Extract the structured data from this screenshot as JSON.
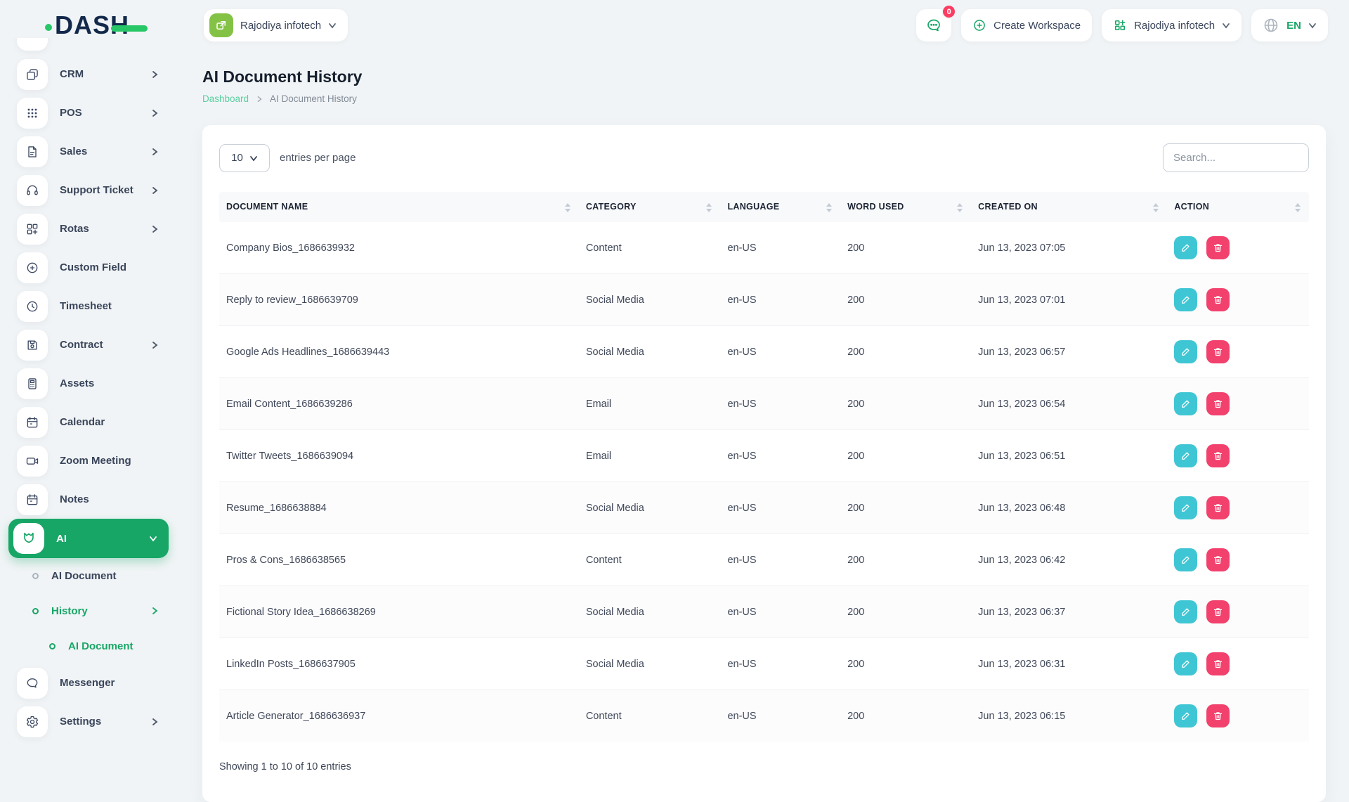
{
  "app": {
    "logo": "DASH"
  },
  "header": {
    "workspace_switcher": "Rajodiya infotech",
    "messages_badge": "0",
    "create_workspace_label": "Create Workspace",
    "company_menu": "Rajodiya infotech",
    "language": "EN"
  },
  "sidebar": {
    "items": [
      {
        "label": "CRM",
        "icon": "crm-icon",
        "chevron": true
      },
      {
        "label": "POS",
        "icon": "pos-grid-icon",
        "chevron": true
      },
      {
        "label": "Sales",
        "icon": "document-icon",
        "chevron": true
      },
      {
        "label": "Support Ticket",
        "icon": "headset-icon",
        "chevron": true
      },
      {
        "label": "Rotas",
        "icon": "squares-plus-icon",
        "chevron": true
      },
      {
        "label": "Custom Field",
        "icon": "circle-plus-icon",
        "chevron": false
      },
      {
        "label": "Timesheet",
        "icon": "clock-icon",
        "chevron": false
      },
      {
        "label": "Contract",
        "icon": "floppy-icon",
        "chevron": true
      },
      {
        "label": "Assets",
        "icon": "calculator-icon",
        "chevron": false
      },
      {
        "label": "Calendar",
        "icon": "calendar-icon",
        "chevron": false
      },
      {
        "label": "Zoom Meeting",
        "icon": "video-camera-icon",
        "chevron": false
      },
      {
        "label": "Notes",
        "icon": "calendar-icon",
        "chevron": false
      }
    ],
    "ai_item": {
      "label": "AI",
      "active": true
    },
    "ai_children": [
      {
        "label": "AI Document",
        "active": false
      },
      {
        "label": "History",
        "active": true,
        "chevron": true
      }
    ],
    "history_children": [
      {
        "label": "AI Document",
        "active": true
      }
    ],
    "bottom_items": [
      {
        "label": "Messenger",
        "icon": "chat-bubble-icon",
        "chevron": false
      },
      {
        "label": "Settings",
        "icon": "gear-icon",
        "chevron": true
      }
    ]
  },
  "page": {
    "title": "AI Document History",
    "breadcrumb_link": "Dashboard",
    "breadcrumb_current": "AI Document History"
  },
  "table_controls": {
    "page_size": "10",
    "entries_label": "entries per page",
    "search_placeholder": "Search..."
  },
  "table": {
    "columns": [
      "DOCUMENT NAME",
      "CATEGORY",
      "LANGUAGE",
      "WORD USED",
      "CREATED ON",
      "ACTION"
    ],
    "rows": [
      {
        "name": "Company Bios_1686639932",
        "category": "Content",
        "language": "en-US",
        "words": "200",
        "created": "Jun 13, 2023 07:05"
      },
      {
        "name": "Reply to review_1686639709",
        "category": "Social Media",
        "language": "en-US",
        "words": "200",
        "created": "Jun 13, 2023 07:01"
      },
      {
        "name": "Google Ads Headlines_1686639443",
        "category": "Social Media",
        "language": "en-US",
        "words": "200",
        "created": "Jun 13, 2023 06:57"
      },
      {
        "name": "Email Content_1686639286",
        "category": "Email",
        "language": "en-US",
        "words": "200",
        "created": "Jun 13, 2023 06:54"
      },
      {
        "name": "Twitter Tweets_1686639094",
        "category": "Email",
        "language": "en-US",
        "words": "200",
        "created": "Jun 13, 2023 06:51"
      },
      {
        "name": "Resume_1686638884",
        "category": "Social Media",
        "language": "en-US",
        "words": "200",
        "created": "Jun 13, 2023 06:48"
      },
      {
        "name": "Pros & Cons_1686638565",
        "category": "Content",
        "language": "en-US",
        "words": "200",
        "created": "Jun 13, 2023 06:42"
      },
      {
        "name": "Fictional Story Idea_1686638269",
        "category": "Social Media",
        "language": "en-US",
        "words": "200",
        "created": "Jun 13, 2023 06:37"
      },
      {
        "name": "LinkedIn Posts_1686637905",
        "category": "Social Media",
        "language": "en-US",
        "words": "200",
        "created": "Jun 13, 2023 06:31"
      },
      {
        "name": "Article Generator_1686636937",
        "category": "Content",
        "language": "en-US",
        "words": "200",
        "created": "Jun 13, 2023 06:15"
      }
    ],
    "footer": "Showing 1 to 10 of 10 entries"
  },
  "colors": {
    "brand_green": "#17a666",
    "logo_navy": "#13294b",
    "logo_green": "#27c768",
    "breadcrumb_link_green": "#59d0a0",
    "workspace_icon_green": "#84c245",
    "edit_button_teal": "#3fc6d4",
    "delete_button_pink": "#f1416c",
    "badge_red": "#fb3c63"
  }
}
